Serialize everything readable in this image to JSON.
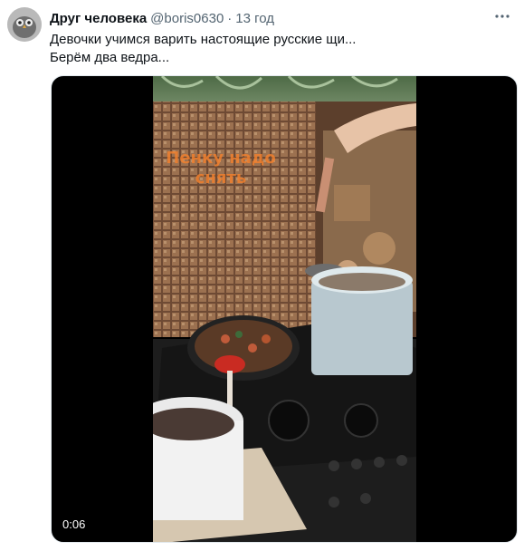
{
  "tweet": {
    "author_name": "Друг человека",
    "handle": "@boris0630",
    "separator": "·",
    "time": "13 год",
    "text_lines": [
      "Девочки учимся варить настоящие русские щи...",
      "Берём два ведра..."
    ],
    "avatar_icon": "avatar-owl-photo",
    "more_icon": "more-dots-icon"
  },
  "media": {
    "type": "video",
    "duration": "0:06",
    "overlay_text_lines": [
      "Пенку надо",
      "снять"
    ],
    "play_icon": "video-thumbnail"
  }
}
